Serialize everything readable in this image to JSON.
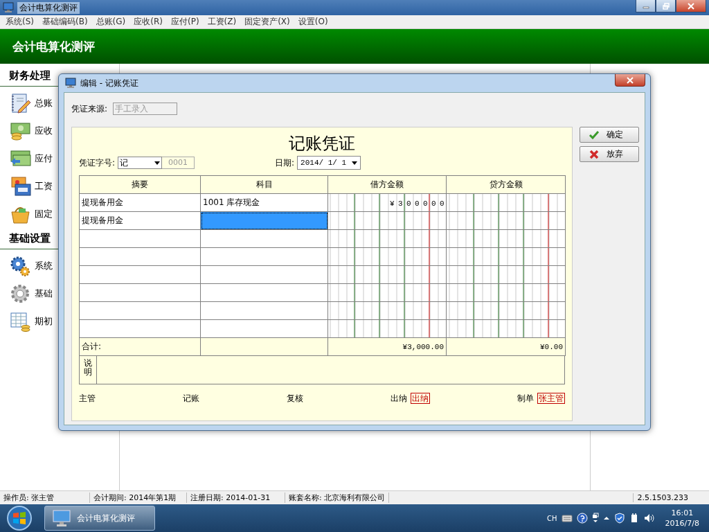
{
  "window": {
    "title": "会计电算化测评"
  },
  "menu": [
    "系统(S)",
    "基础编码(B)",
    "总账(G)",
    "应收(R)",
    "应付(P)",
    "工资(Z)",
    "固定资产(X)",
    "设置(O)"
  ],
  "header": {
    "title": "会计电算化测评"
  },
  "sidebar": {
    "sections": [
      {
        "title": "财务处理",
        "items": [
          {
            "label": "总账",
            "kind": "ledger"
          },
          {
            "label": "应收",
            "kind": "receivable"
          },
          {
            "label": "应付",
            "kind": "payable"
          },
          {
            "label": "工资",
            "kind": "salary"
          },
          {
            "label": "固定",
            "kind": "assets"
          }
        ]
      },
      {
        "title": "基础设置",
        "items": [
          {
            "label": "系统",
            "kind": "gears"
          },
          {
            "label": "基础",
            "kind": "gear"
          },
          {
            "label": "期初",
            "kind": "table"
          }
        ]
      }
    ]
  },
  "dialog": {
    "title": "编辑 - 记账凭证",
    "source_label": "凭证来源:",
    "source_value": "手工录入",
    "source_disabled": true,
    "voucher": {
      "title": "记账凭证",
      "word_label": "凭证字号:",
      "word_value": "记",
      "number": "0001",
      "number_disabled": true,
      "date_label": "日期:",
      "date_value": "2014/ 1/ 1",
      "columns": [
        "摘要",
        "科目",
        "借方金额",
        "贷方金额"
      ],
      "rows": [
        {
          "summary": "提现备用金",
          "account": "1001  库存现金",
          "debit": "¥300000",
          "account_selected": false
        },
        {
          "summary": "提现备用金",
          "account_selected": true
        },
        {
          "account_selected": false
        },
        {
          "account_selected": false
        },
        {
          "account_selected": false
        },
        {
          "account_selected": false
        },
        {
          "account_selected": false
        },
        {
          "account_selected": false
        }
      ],
      "total_label": "合计:",
      "total_debit": "¥3,000.00",
      "total_credit": "¥0.00",
      "note_label": "说明",
      "signatures": [
        {
          "label": "主管"
        },
        {
          "label": "记账"
        },
        {
          "label": "复核"
        },
        {
          "label": "出纳",
          "stamp": "出纳"
        },
        {
          "label": "制单",
          "stamp": "张主管"
        }
      ]
    },
    "buttons": [
      {
        "label": "确定",
        "kind": "ok"
      },
      {
        "label": "放弃",
        "kind": "cancel"
      }
    ]
  },
  "status_bar": [
    "操作员: 张主管",
    "会计期间: 2014年第1期",
    "注册日期: 2014-01-31",
    "账套名称: 北京海利有限公司",
    "2.5.1503.233"
  ],
  "taskbar": {
    "task": "会计电算化测评",
    "language": "CH",
    "time": "16:01",
    "date": "2016/7/8"
  }
}
